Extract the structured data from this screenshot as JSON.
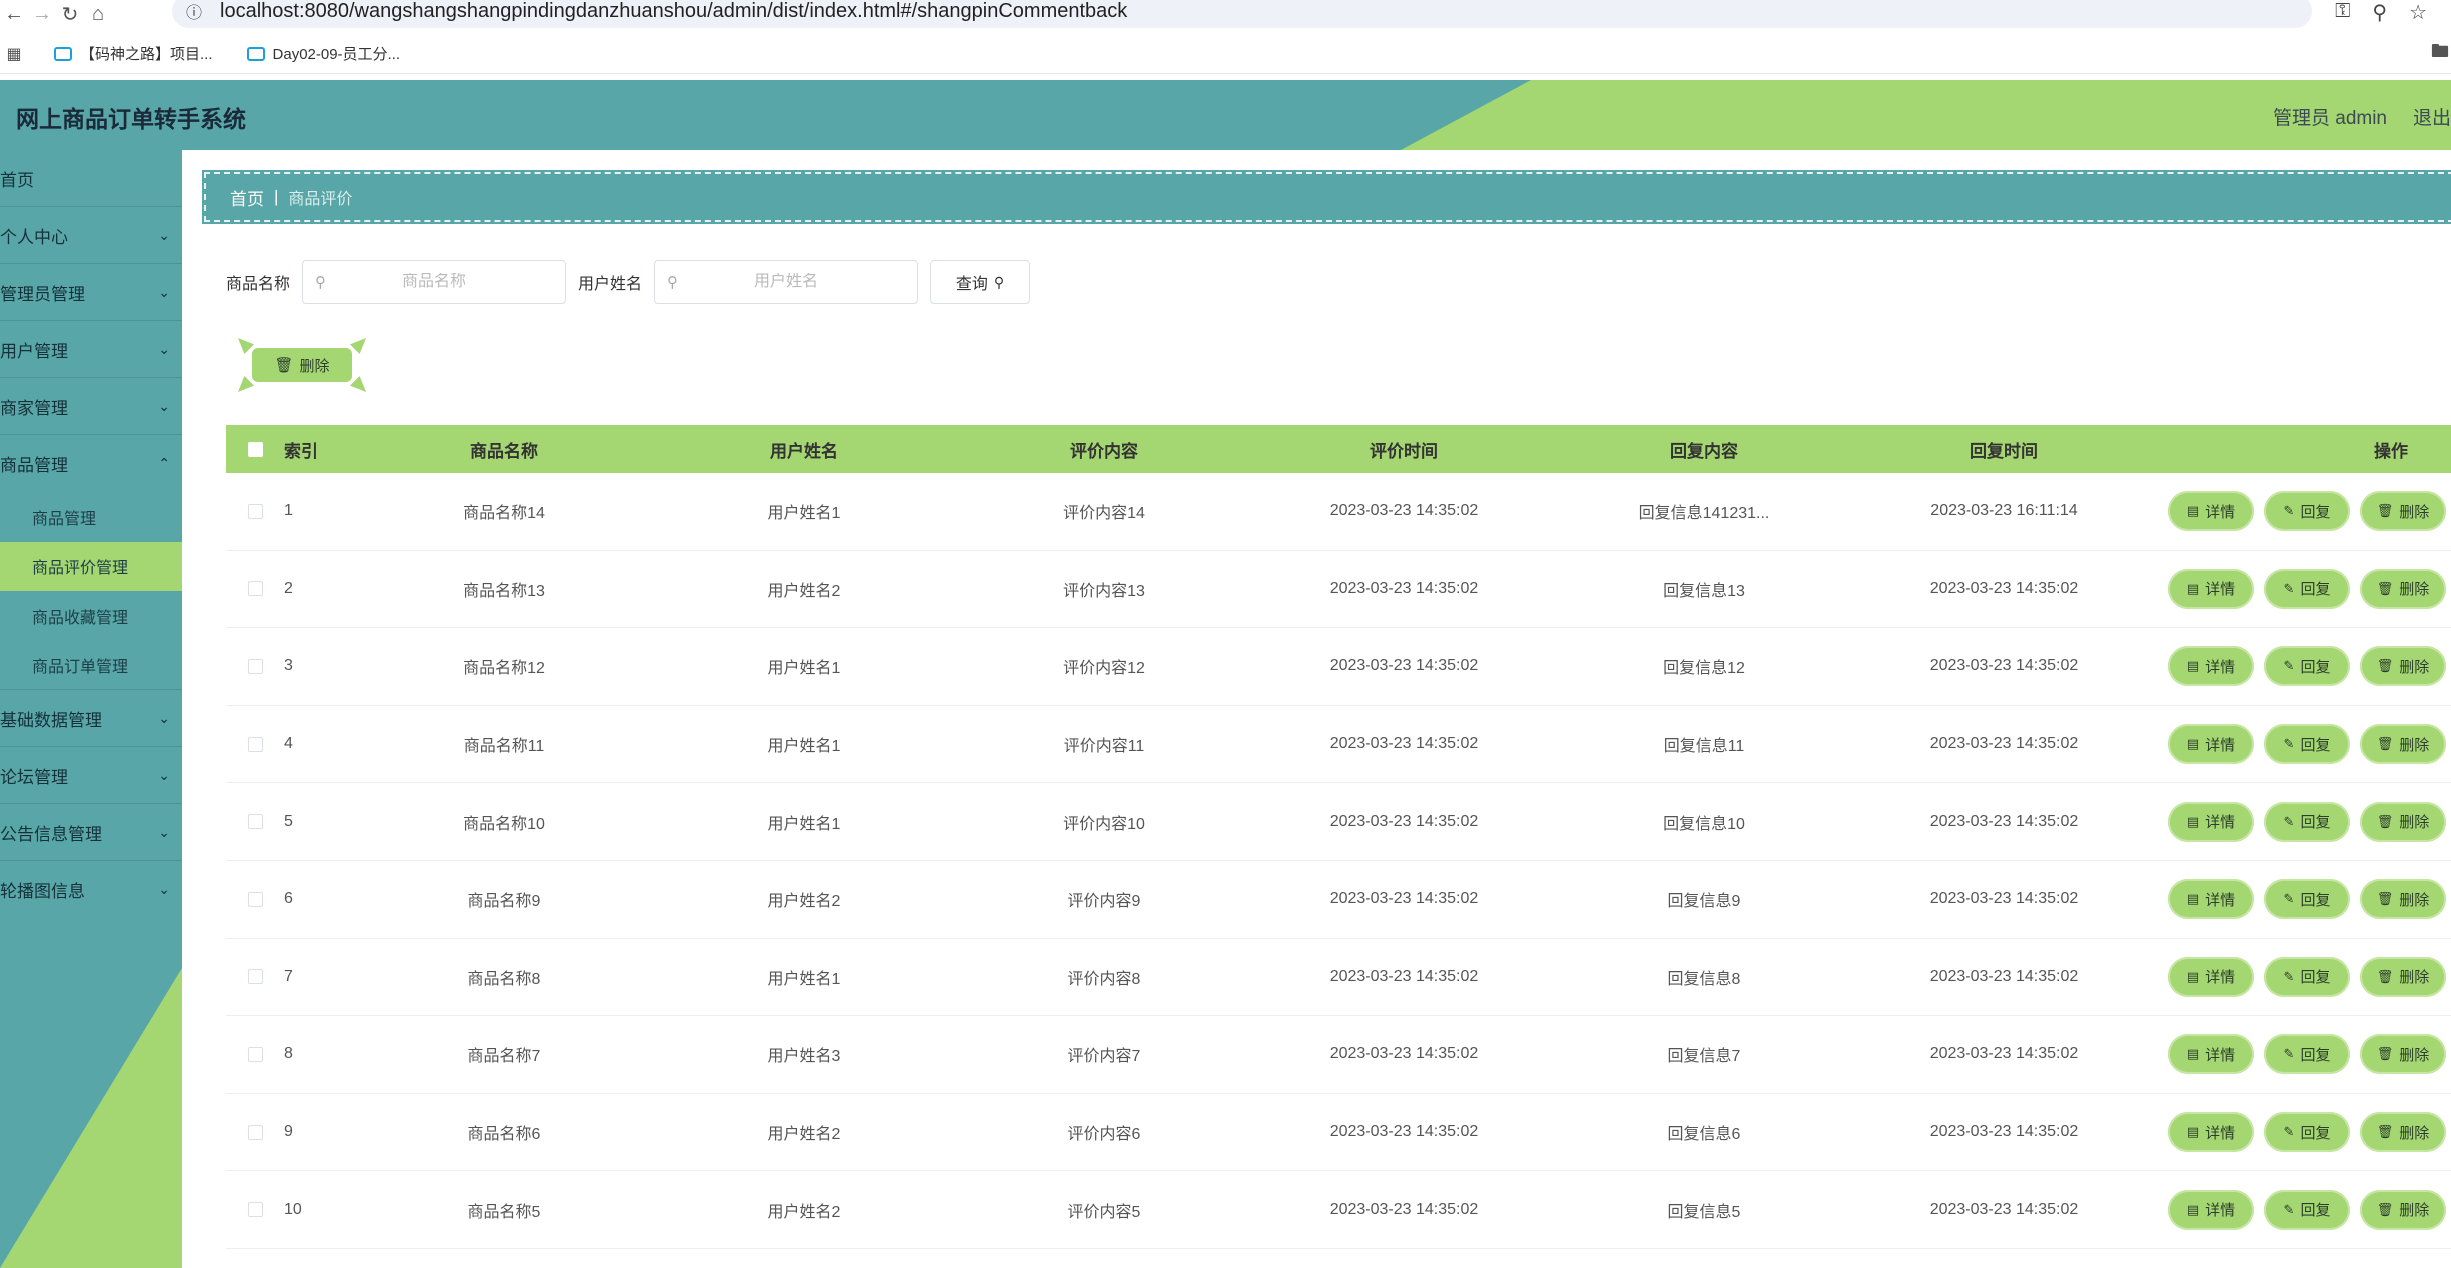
{
  "browser": {
    "url": "localhost:8080/wangshangshangpindingdanzhuanshou/admin/dist/index.html#/shangpinCommentback",
    "bookmarks": [
      "【码神之路】项目...",
      "Day02-09-员工分..."
    ]
  },
  "header": {
    "title": "网上商品订单转手系统",
    "user": "管理员 admin",
    "logout": "退出"
  },
  "sidebar": {
    "items": [
      {
        "label": "首页"
      },
      {
        "label": "个人中心"
      },
      {
        "label": "管理员管理"
      },
      {
        "label": "用户管理"
      },
      {
        "label": "商家管理"
      },
      {
        "label": "商品管理"
      }
    ],
    "sub_items": [
      {
        "label": "商品管理"
      },
      {
        "label": "商品评价管理"
      },
      {
        "label": "商品收藏管理"
      },
      {
        "label": "商品订单管理"
      }
    ],
    "items_after": [
      {
        "label": "基础数据管理"
      },
      {
        "label": "论坛管理"
      },
      {
        "label": "公告信息管理"
      },
      {
        "label": "轮播图信息"
      }
    ]
  },
  "breadcrumb": {
    "home": "首页",
    "sep": "|",
    "current": "商品评价"
  },
  "search": {
    "name_label": "商品名称",
    "name_placeholder": "商品名称",
    "user_label": "用户姓名",
    "user_placeholder": "用户姓名",
    "query_label": "查询"
  },
  "delete_label": "删除",
  "table": {
    "headers": [
      "索引",
      "商品名称",
      "用户姓名",
      "评价内容",
      "评价时间",
      "回复内容",
      "回复时间",
      "操作"
    ],
    "rows": [
      [
        "1",
        "商品名称14",
        "用户姓名1",
        "评价内容14",
        "2023-03-23 14:35:02",
        "回复信息141231...",
        "2023-03-23 16:11:14"
      ],
      [
        "2",
        "商品名称13",
        "用户姓名2",
        "评价内容13",
        "2023-03-23 14:35:02",
        "回复信息13",
        "2023-03-23 14:35:02"
      ],
      [
        "3",
        "商品名称12",
        "用户姓名1",
        "评价内容12",
        "2023-03-23 14:35:02",
        "回复信息12",
        "2023-03-23 14:35:02"
      ],
      [
        "4",
        "商品名称11",
        "用户姓名1",
        "评价内容11",
        "2023-03-23 14:35:02",
        "回复信息11",
        "2023-03-23 14:35:02"
      ],
      [
        "5",
        "商品名称10",
        "用户姓名1",
        "评价内容10",
        "2023-03-23 14:35:02",
        "回复信息10",
        "2023-03-23 14:35:02"
      ],
      [
        "6",
        "商品名称9",
        "用户姓名2",
        "评价内容9",
        "2023-03-23 14:35:02",
        "回复信息9",
        "2023-03-23 14:35:02"
      ],
      [
        "7",
        "商品名称8",
        "用户姓名1",
        "评价内容8",
        "2023-03-23 14:35:02",
        "回复信息8",
        "2023-03-23 14:35:02"
      ],
      [
        "8",
        "商品名称7",
        "用户姓名3",
        "评价内容7",
        "2023-03-23 14:35:02",
        "回复信息7",
        "2023-03-23 14:35:02"
      ],
      [
        "9",
        "商品名称6",
        "用户姓名2",
        "评价内容6",
        "2023-03-23 14:35:02",
        "回复信息6",
        "2023-03-23 14:35:02"
      ],
      [
        "10",
        "商品名称5",
        "用户姓名2",
        "评价内容5",
        "2023-03-23 14:35:02",
        "回复信息5",
        "2023-03-23 14:35:02"
      ]
    ],
    "ops": [
      "详情",
      "回复",
      "删除"
    ]
  },
  "colors": {
    "teal": "#58a6a8",
    "green": "#a4d671"
  }
}
